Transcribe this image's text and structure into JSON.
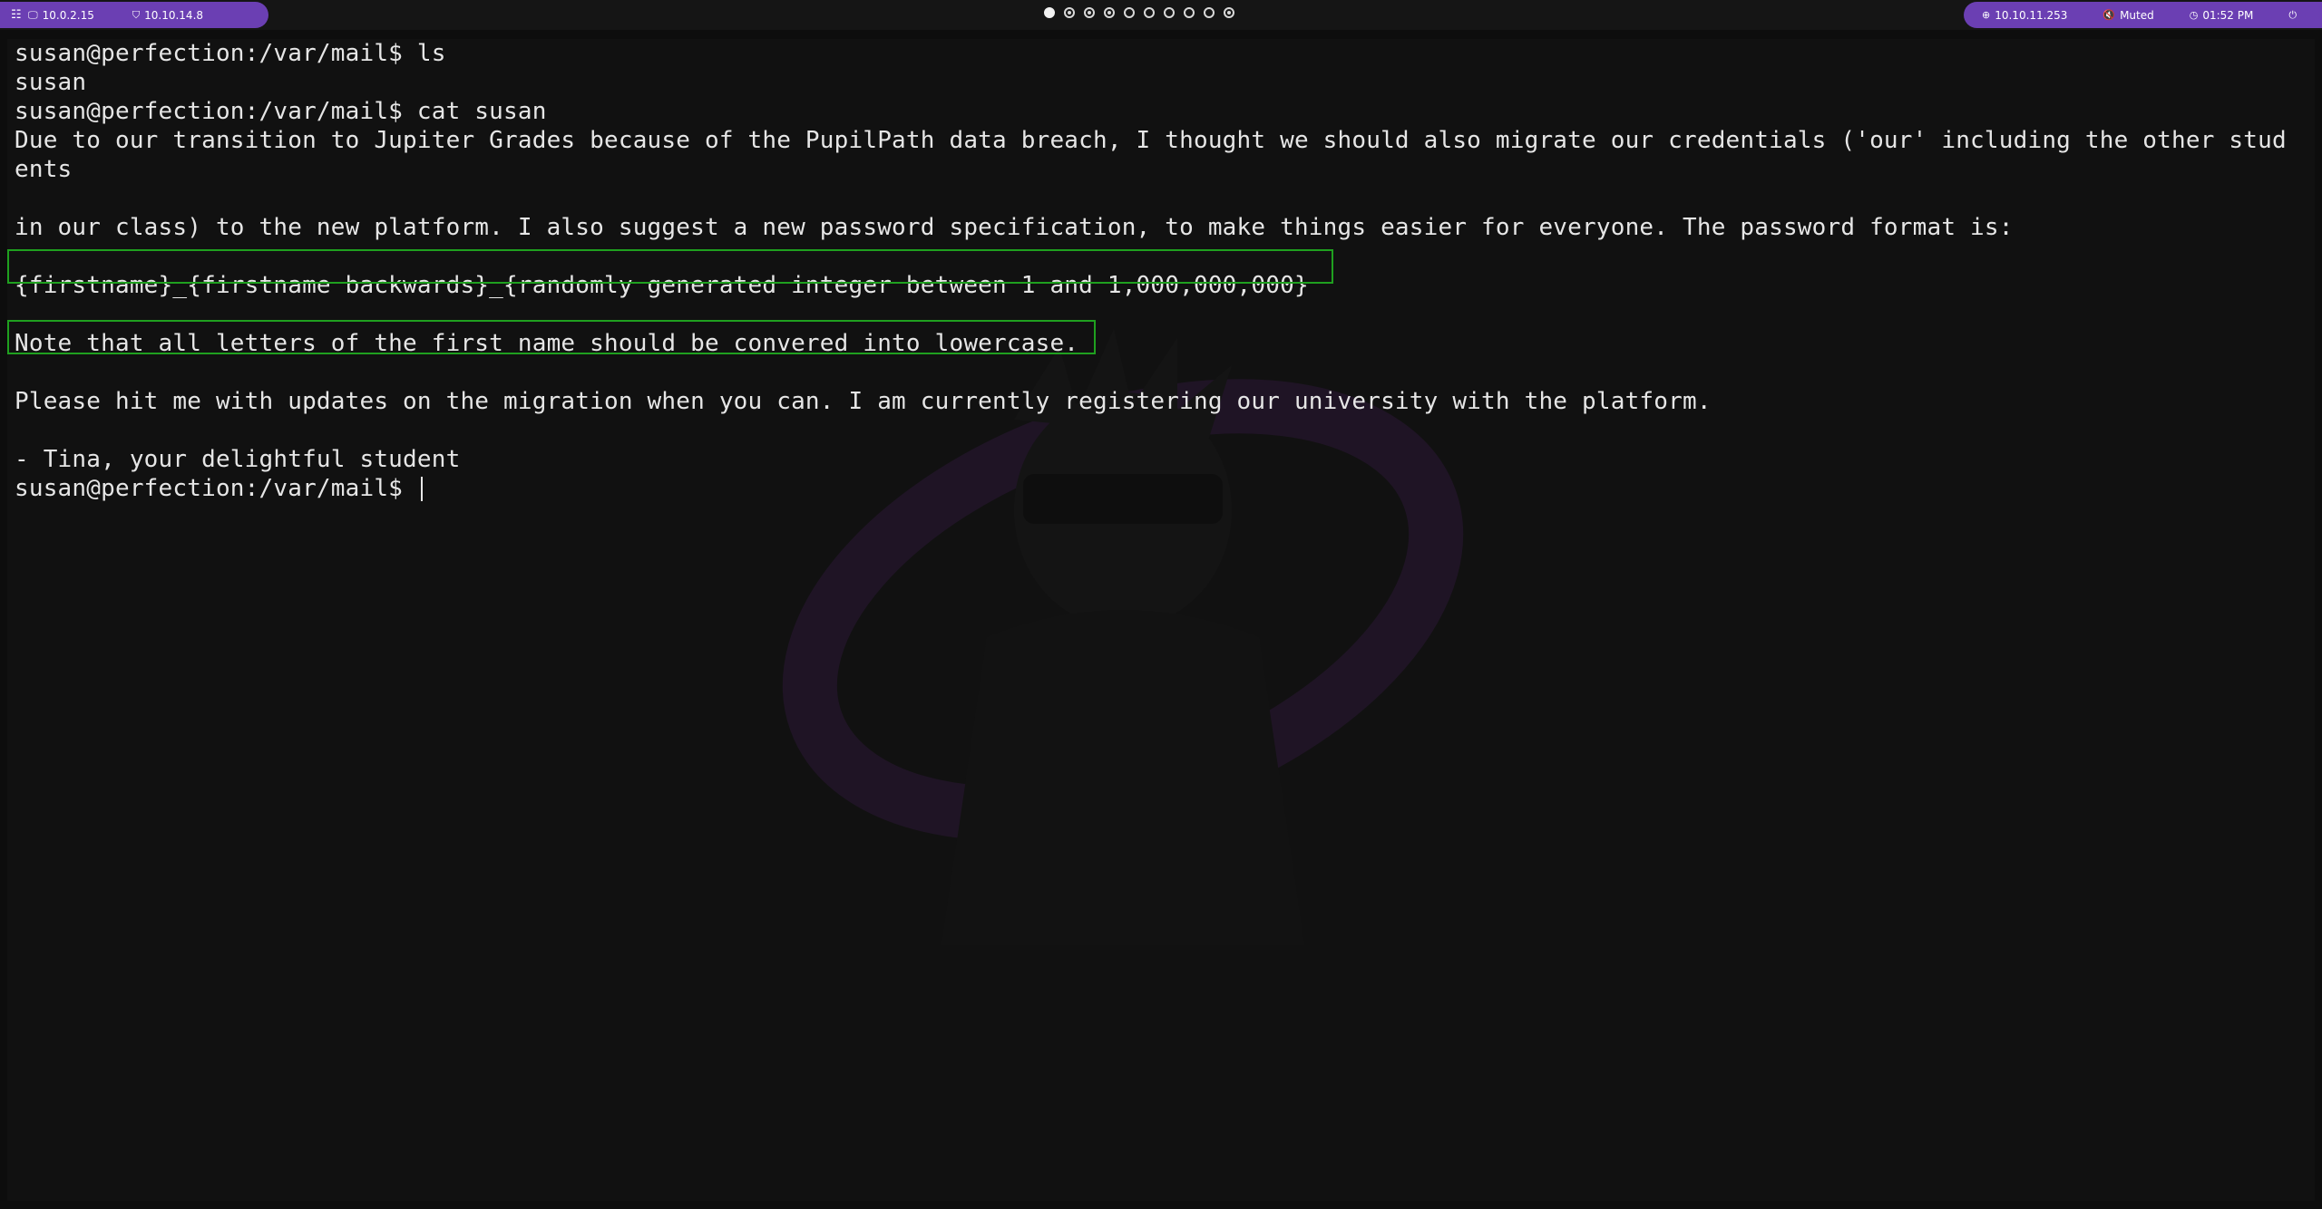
{
  "topbar": {
    "left_items": [
      {
        "icon": "monitor-icon",
        "label": "10.0.2.15"
      },
      {
        "icon": "shield-icon",
        "label": "10.10.14.8"
      }
    ],
    "workspaces": [
      "active",
      "occupied",
      "occupied",
      "occupied",
      "empty",
      "empty",
      "empty",
      "empty",
      "empty",
      "occupied"
    ],
    "right_items": [
      {
        "icon": "target-icon",
        "label": "10.10.11.253"
      },
      {
        "icon": "speaker-muted-icon",
        "label": "Muted"
      },
      {
        "icon": "clock-icon",
        "label": "01:52 PM"
      },
      {
        "icon": "power-icon",
        "label": ""
      }
    ],
    "accent": "#6b3fb3"
  },
  "terminal": {
    "lines": [
      "susan@perfection:/var/mail$ ls",
      "susan",
      "susan@perfection:/var/mail$ cat susan",
      "Due to our transition to Jupiter Grades because of the PupilPath data breach, I thought we should also migrate our credentials ('our' including the other stud",
      "ents",
      "",
      "in our class) to the new platform. I also suggest a new password specification, to make things easier for everyone. The password format is:",
      "",
      "{firstname}_{firstname backwards}_{randomly generated integer between 1 and 1,000,000,000}",
      "",
      "Note that all letters of the first name should be convered into lowercase.",
      "",
      "Please hit me with updates on the migration when you can. I am currently registering our university with the platform.",
      "",
      "- Tina, your delightful student"
    ],
    "prompt": "susan@perfection:/var/mail$ ",
    "highlight_color": "#1fa01f"
  }
}
